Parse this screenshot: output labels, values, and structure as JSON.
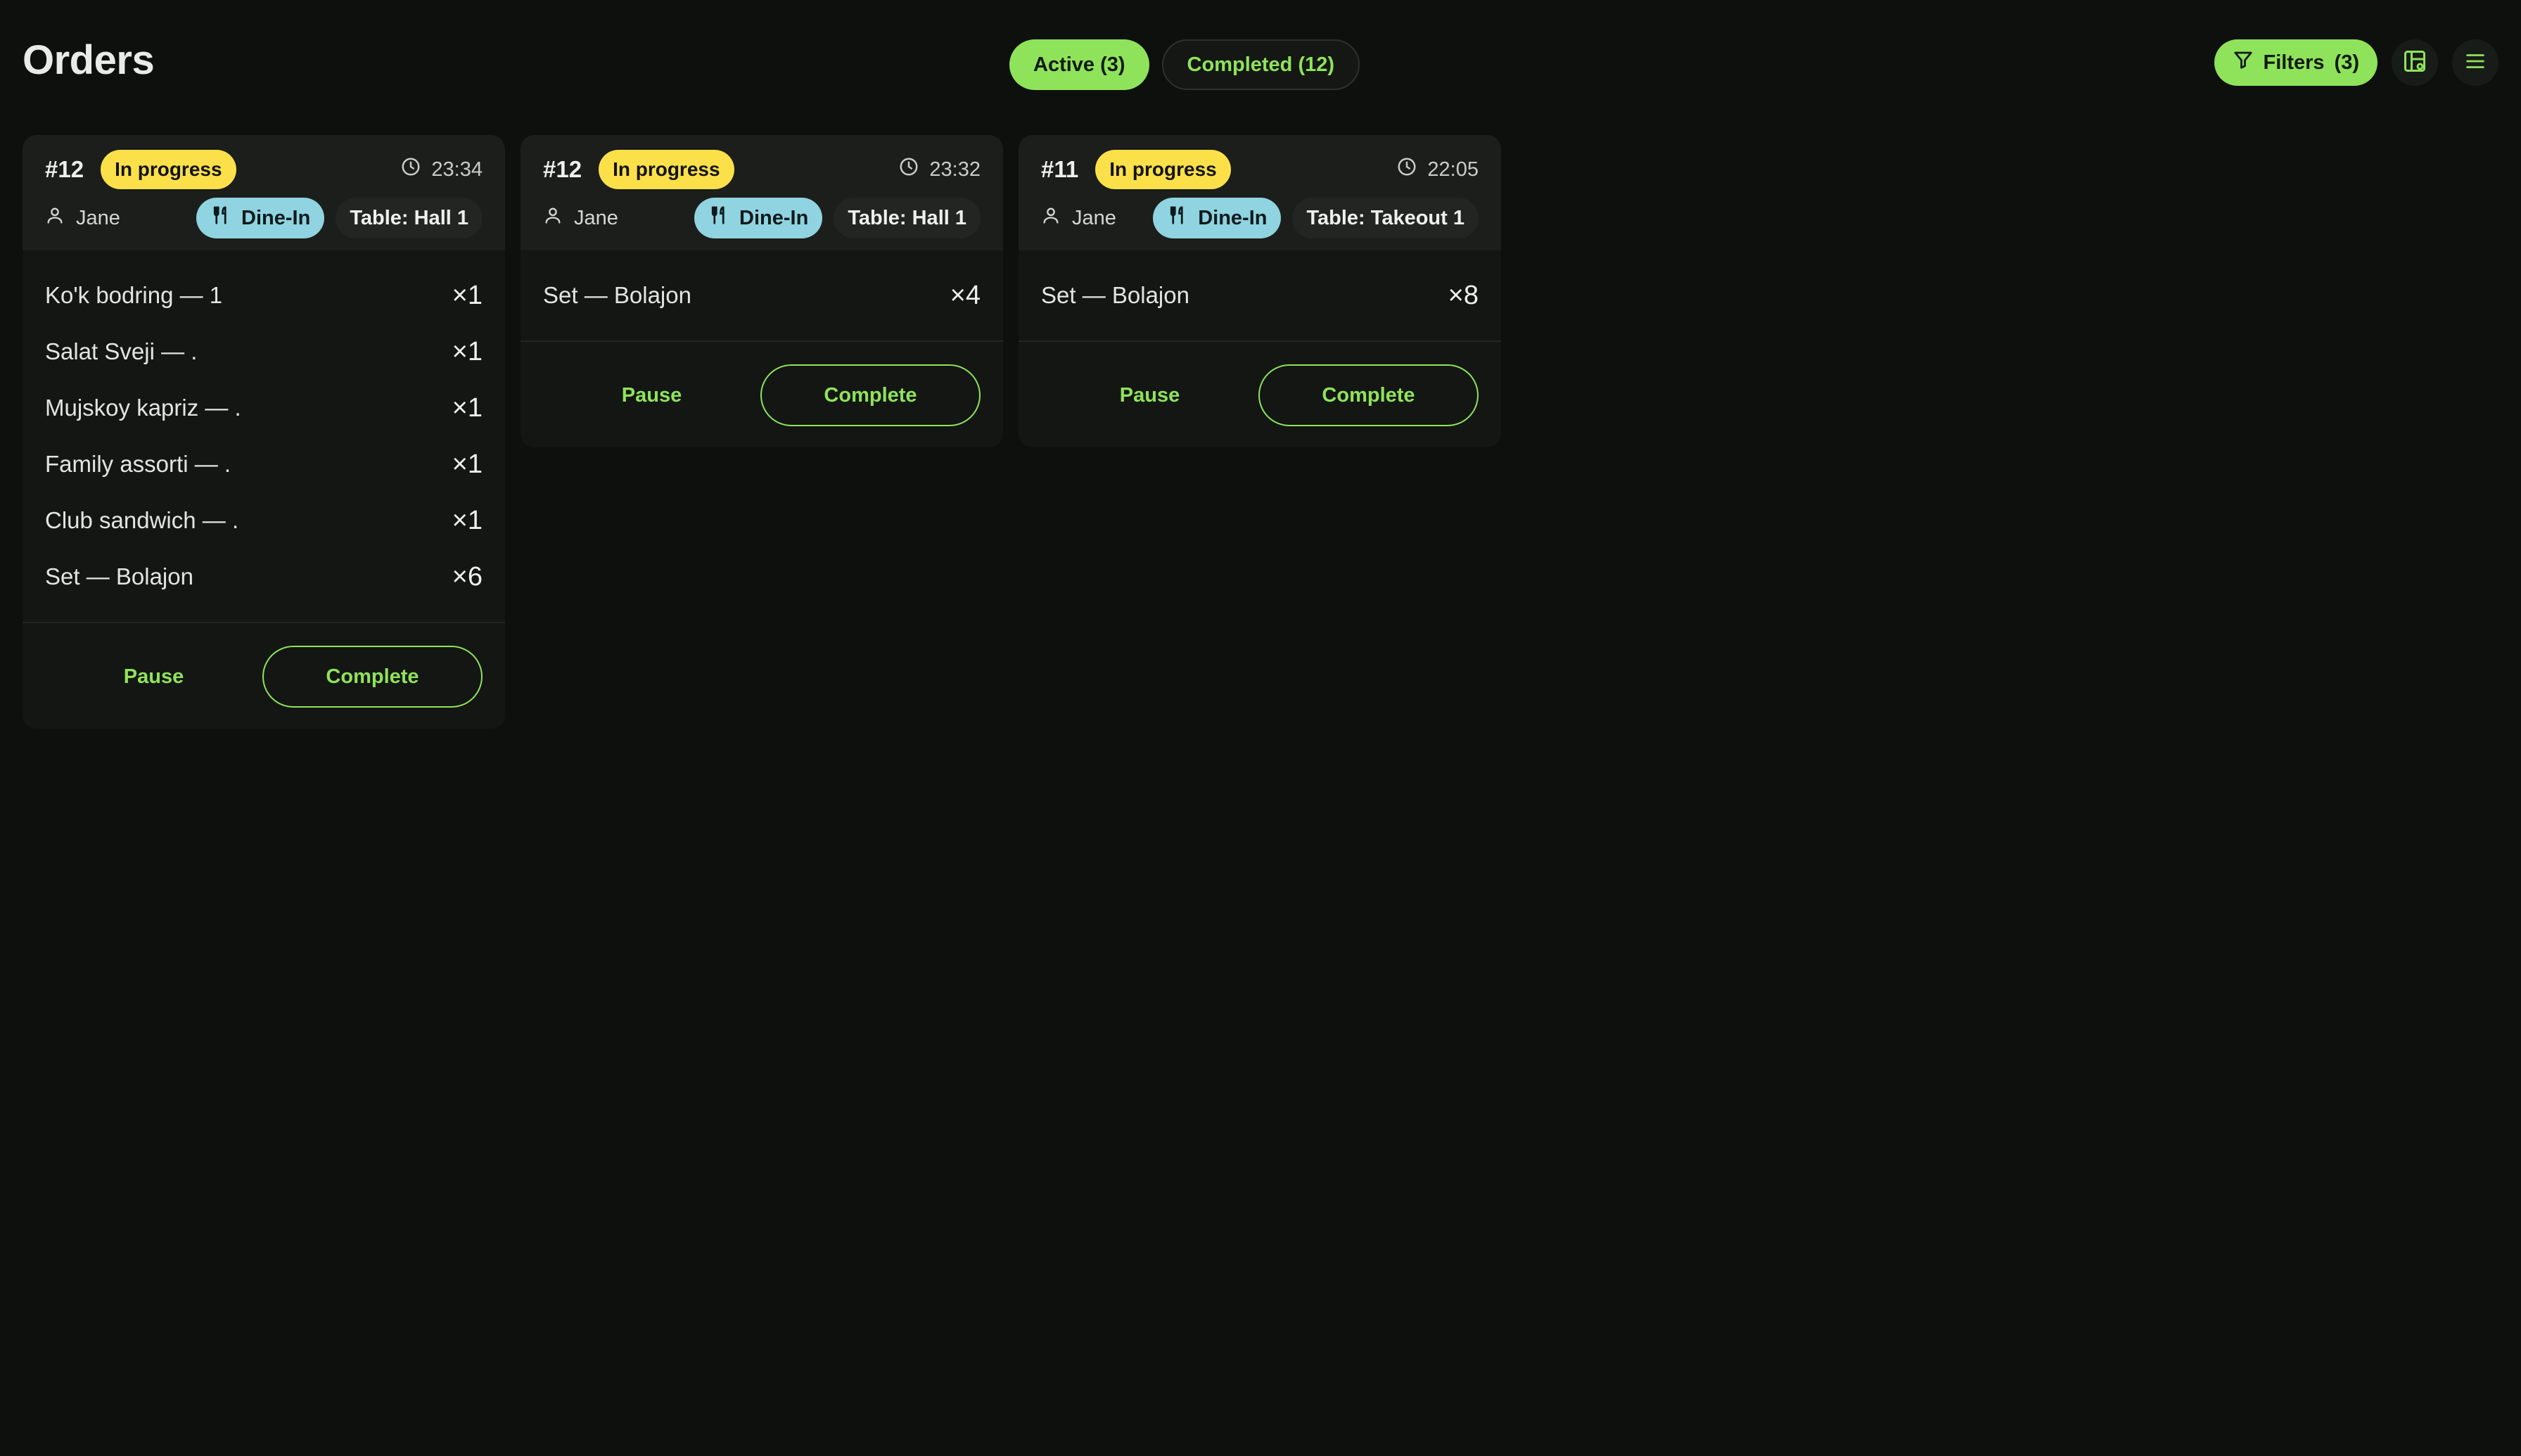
{
  "header": {
    "title": "Orders"
  },
  "tabs": [
    {
      "label": "Active (3)",
      "active": true
    },
    {
      "label": "Completed (12)",
      "active": false
    }
  ],
  "toolbar": {
    "filters_label": "Filters",
    "filters_count": "(3)"
  },
  "colors": {
    "accent": "#8fe35a",
    "status_in_progress": "#fbe04a",
    "dine_in": "#8fd4e0",
    "background": "#0e100e"
  },
  "orders": [
    {
      "number": "#12",
      "status": "In progress",
      "time": "23:34",
      "waiter": "Jane",
      "type": "Dine-In",
      "table": "Table: Hall 1",
      "items": [
        {
          "name": "Ko'k bodring — 1",
          "qty": "×1"
        },
        {
          "name": "Salat Sveji — .",
          "qty": "×1"
        },
        {
          "name": "Mujskoy kapriz — .",
          "qty": "×1"
        },
        {
          "name": "Family assorti — .",
          "qty": "×1"
        },
        {
          "name": "Club sandwich — .",
          "qty": "×1"
        },
        {
          "name": "Set — Bolajon",
          "qty": "×6"
        }
      ],
      "pause_label": "Pause",
      "complete_label": "Complete"
    },
    {
      "number": "#12",
      "status": "In progress",
      "time": "23:32",
      "waiter": "Jane",
      "type": "Dine-In",
      "table": "Table: Hall 1",
      "items": [
        {
          "name": "Set — Bolajon",
          "qty": "×4"
        }
      ],
      "pause_label": "Pause",
      "complete_label": "Complete"
    },
    {
      "number": "#11",
      "status": "In progress",
      "time": "22:05",
      "waiter": "Jane",
      "type": "Dine-In",
      "table": "Table: Takeout 1",
      "items": [
        {
          "name": "Set — Bolajon",
          "qty": "×8"
        }
      ],
      "pause_label": "Pause",
      "complete_label": "Complete"
    }
  ]
}
